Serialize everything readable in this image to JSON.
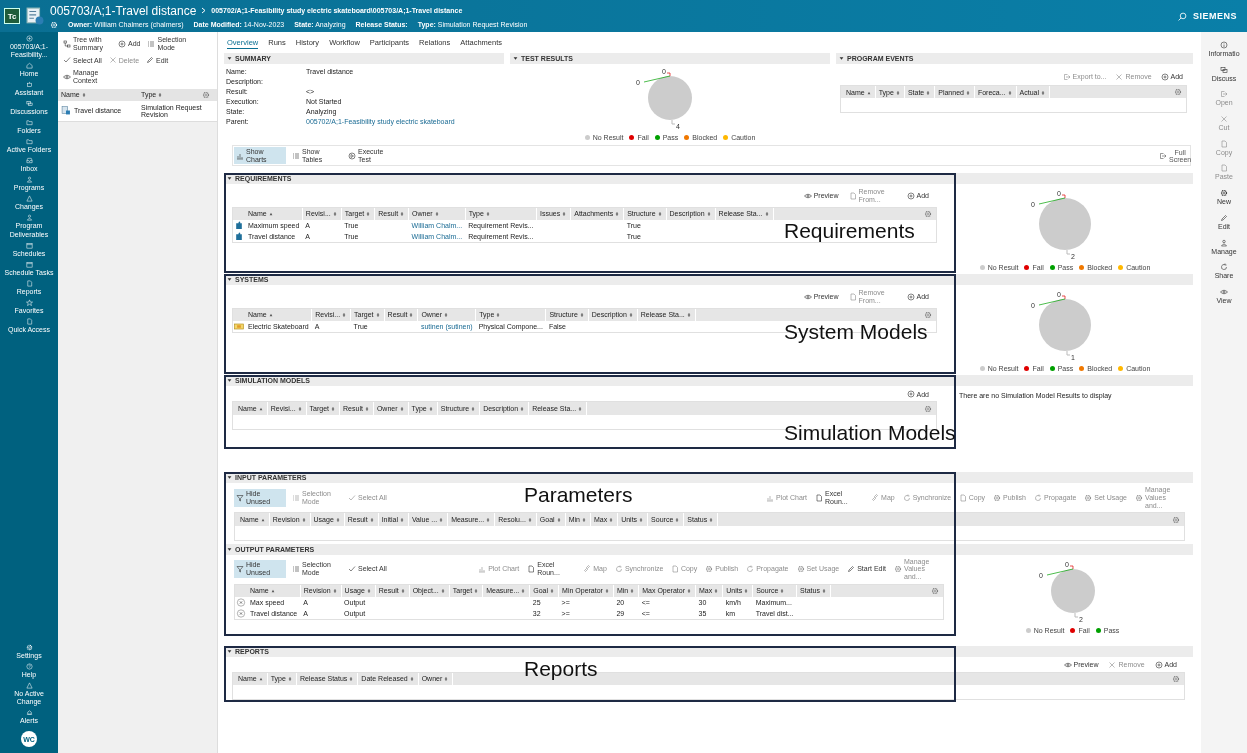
{
  "header": {
    "logo": "Tc",
    "title": "005703/A;1-Travel distance",
    "breadcrumb": "005702/A;1-Feasibility study electric skateboard\\005703/A;1-Travel distance",
    "meta": [
      {
        "label": "Owner:",
        "value": "William Chalmers (chalmers)"
      },
      {
        "label": "Date Modified:",
        "value": "14-Nov-2023"
      },
      {
        "label": "State:",
        "value": "Analyzing"
      },
      {
        "label": "Release Status:"
      },
      {
        "label": "Type:",
        "value": "Simulation Request Revision"
      }
    ],
    "brand": "SIEMENS"
  },
  "nav_rail": {
    "context": "005703/A;1-Feasibility...",
    "items": [
      {
        "label": "Home",
        "kind": "home"
      },
      {
        "label": "Assistant",
        "kind": "bot"
      },
      {
        "label": "Discussions",
        "kind": "chat"
      },
      {
        "label": "Folders",
        "kind": "folder"
      },
      {
        "label": "Active Folders",
        "kind": "folder"
      },
      {
        "label": "Inbox",
        "kind": "inbox"
      },
      {
        "label": "Programs",
        "kind": "people"
      },
      {
        "label": "Changes",
        "kind": "triangle"
      },
      {
        "label": "Program Deliverables",
        "kind": "people"
      },
      {
        "label": "Schedules",
        "kind": "calendar"
      },
      {
        "label": "Schedule Tasks",
        "kind": "calendar"
      },
      {
        "label": "Reports",
        "kind": "doc"
      },
      {
        "label": "Favorites",
        "kind": "star"
      },
      {
        "label": "Quick Access",
        "kind": "doc"
      }
    ],
    "bottom": [
      {
        "label": "Settings",
        "kind": "gear"
      },
      {
        "label": "Help",
        "kind": "help"
      },
      {
        "label": "No Active Change",
        "kind": "triangle"
      },
      {
        "label": "Alerts",
        "kind": "bell"
      }
    ],
    "avatar": "WC"
  },
  "tree_panel": {
    "toolbar": [
      {
        "label": "Tree with Summary",
        "kind": "tree",
        "disabled": false
      },
      {
        "label": "Add",
        "kind": "plus",
        "disabled": false
      },
      {
        "label": "Selection Mode",
        "kind": "list",
        "disabled": false
      },
      {
        "label": "Select All",
        "kind": "check",
        "disabled": false
      },
      {
        "label": "Delete",
        "kind": "cross",
        "disabled": true
      },
      {
        "label": "Edit",
        "kind": "pencil",
        "disabled": false
      },
      {
        "label": "Manage Context",
        "kind": "eye",
        "disabled": false
      }
    ],
    "columns": [
      {
        "label": "Name",
        "sorted": false
      },
      {
        "label": "Type",
        "sorted": false
      }
    ],
    "rows": [
      {
        "kind": "simulation-request",
        "cells": [
          "Travel distance",
          "Simulation Request Revision"
        ]
      }
    ]
  },
  "tabs": [
    {
      "label": "Overview",
      "selected": true
    },
    {
      "label": "Runs",
      "selected": false
    },
    {
      "label": "History",
      "selected": false
    },
    {
      "label": "Workflow",
      "selected": false
    },
    {
      "label": "Participants",
      "selected": false
    },
    {
      "label": "Relations",
      "selected": false
    },
    {
      "label": "Attachments",
      "selected": false
    }
  ],
  "summary": {
    "title": "SUMMARY",
    "fields": [
      {
        "label": "Name:",
        "value": "Travel distance"
      },
      {
        "label": "Description:"
      },
      {
        "label": "Result:",
        "value": "<>"
      },
      {
        "label": "Execution:",
        "value": "Not Started"
      },
      {
        "label": "State:",
        "value": "Analyzing"
      },
      {
        "label": "Parent:",
        "value": {
          "text": "005702/A;1-Feasibility study electric skateboard",
          "link": true
        }
      }
    ]
  },
  "test_results": {
    "title": "TEST RESULTS",
    "chart": {
      "chart_data": {
        "type": "pie",
        "categories": [
          "No Result",
          "Fail",
          "Pass",
          "Blocked",
          "Caution"
        ],
        "values": [
          4,
          0,
          0,
          null,
          null
        ],
        "data_labels": true,
        "value_labels": [
          "4",
          "0",
          "0",
          null,
          null
        ]
      },
      "legend": [
        {
          "color": "#cccccc"
        },
        {
          "color": "#e00000"
        },
        {
          "color": "#00a000"
        },
        {
          "color": "#f07800"
        },
        {
          "color": "#ffb800"
        }
      ]
    }
  },
  "program_events": {
    "title": "PROGRAM EVENTS",
    "toolbar": [
      {
        "label": "Export to...",
        "kind": "export",
        "disabled": true
      },
      {
        "label": "Remove",
        "kind": "cross",
        "disabled": true
      },
      {
        "label": "Add",
        "kind": "plus",
        "disabled": false
      }
    ],
    "table": {
      "columns": [
        {
          "label": "Name",
          "sorted": true
        },
        {
          "label": "Type",
          "sorted": false
        },
        {
          "label": "State",
          "sorted": false
        },
        {
          "label": "Planned",
          "sorted": false
        },
        {
          "label": "Foreca...",
          "sorted": false
        },
        {
          "label": "Actual",
          "sorted": false
        }
      ]
    }
  },
  "view_toolbar": {
    "items": [
      {
        "label": "Show Charts",
        "kind": "chart",
        "selected": true
      },
      {
        "label": "Show Tables",
        "kind": "list",
        "selected": false
      },
      {
        "label": "Execute Test",
        "kind": "play",
        "selected": false
      }
    ],
    "full_screen": "Full Screen"
  },
  "sections": [
    {
      "title": "REQUIREMENTS",
      "annotation": "Requirements",
      "toolbar": [
        {
          "label": "Preview",
          "kind": "eye",
          "disabled": false
        },
        {
          "label": "Remove From...",
          "kind": "doc",
          "disabled": true
        },
        {
          "label": "Add",
          "kind": "plus",
          "disabled": false
        }
      ],
      "table": {
        "columns": [
          {
            "label": "Name",
            "sorted": true
          },
          {
            "label": "Revisi...",
            "sorted": false
          },
          {
            "label": "Target",
            "sorted": false
          },
          {
            "label": "Result",
            "sorted": false
          },
          {
            "label": "Owner",
            "sorted": false
          },
          {
            "label": "Type",
            "sorted": false
          },
          {
            "label": "Issues",
            "sorted": false
          },
          {
            "label": "Attachments",
            "sorted": false
          },
          {
            "label": "Structure",
            "sorted": false
          },
          {
            "label": "Description",
            "sorted": false
          },
          {
            "label": "Release Sta...",
            "sorted": false
          }
        ],
        "rows": [
          {
            "kind": "requirement",
            "cells": [
              "Maximum speed",
              "A",
              "True",
              "",
              {
                "text": "William Chalm...",
                "link": true
              },
              "Requirement Revis...",
              "",
              "",
              "True",
              "",
              ""
            ]
          },
          {
            "kind": "requirement",
            "cells": [
              "Travel distance",
              "A",
              "True",
              "",
              {
                "text": "William Chalm...",
                "link": true
              },
              "Requirement Revis...",
              "",
              "",
              "True",
              "",
              ""
            ]
          }
        ]
      },
      "chart": {
        "chart_data": {
          "type": "pie",
          "categories": [
            "No Result",
            "Fail",
            "Pass",
            "Blocked",
            "Caution"
          ],
          "values": [
            2,
            0,
            0,
            null,
            null
          ],
          "data_labels": true,
          "value_labels": [
            "2",
            "0",
            "0",
            null,
            null
          ]
        },
        "legend": [
          {
            "color": "#cccccc"
          },
          {
            "color": "#e00000"
          },
          {
            "color": "#00a000"
          },
          {
            "color": "#f07800"
          },
          {
            "color": "#ffb800"
          }
        ]
      }
    },
    {
      "title": "SYSTEMS",
      "annotation": "System Models",
      "toolbar": [
        {
          "label": "Preview",
          "kind": "eye",
          "disabled": false
        },
        {
          "label": "Remove From...",
          "kind": "doc",
          "disabled": true
        },
        {
          "label": "Add",
          "kind": "plus",
          "disabled": false
        }
      ],
      "table": {
        "columns": [
          {
            "label": "Name",
            "sorted": true
          },
          {
            "label": "Revisi...",
            "sorted": false
          },
          {
            "label": "Target",
            "sorted": false
          },
          {
            "label": "Result",
            "sorted": false
          },
          {
            "label": "Owner",
            "sorted": false
          },
          {
            "label": "Type",
            "sorted": false
          },
          {
            "label": "Structure",
            "sorted": false
          },
          {
            "label": "Description",
            "sorted": false
          },
          {
            "label": "Release Sta...",
            "sorted": false
          }
        ],
        "rows": [
          {
            "kind": "system",
            "cells": [
              "Electric Skateboard",
              "A",
              "True",
              "",
              {
                "text": "sutinen (sutinen)",
                "link": true
              },
              "Physical Compone...",
              "False",
              "",
              ""
            ]
          }
        ]
      },
      "chart": {
        "chart_data": {
          "type": "pie",
          "categories": [
            "No Result",
            "Fail",
            "Pass",
            "Blocked",
            "Caution"
          ],
          "values": [
            1,
            0,
            0,
            null,
            null
          ],
          "data_labels": true,
          "value_labels": [
            "1",
            "0",
            "0",
            null,
            null
          ]
        },
        "legend": [
          {
            "color": "#cccccc"
          },
          {
            "color": "#e00000"
          },
          {
            "color": "#00a000"
          },
          {
            "color": "#f07800"
          },
          {
            "color": "#ffb800"
          }
        ]
      }
    },
    {
      "title": "SIMULATION MODELS",
      "annotation": "Simulation Models",
      "toolbar": [
        {
          "label": "Add",
          "kind": "plus",
          "disabled": false
        }
      ],
      "table": {
        "columns": [
          {
            "label": "Name",
            "sorted": true
          },
          {
            "label": "Revisi...",
            "sorted": false
          },
          {
            "label": "Target",
            "sorted": false
          },
          {
            "label": "Result",
            "sorted": false
          },
          {
            "label": "Owner",
            "sorted": false
          },
          {
            "label": "Type",
            "sorted": false
          },
          {
            "label": "Structure",
            "sorted": false
          },
          {
            "label": "Description",
            "sorted": false
          },
          {
            "label": "Release Sta...",
            "sorted": false
          }
        ]
      },
      "message": "There are no Simulation Model Results to display"
    }
  ],
  "parameters": {
    "annotation": "Parameters",
    "groups": [
      {
        "title": "INPUT PARAMETERS",
        "toolbar": [
          {
            "label": "Hide Unused",
            "kind": "filter",
            "selected": true,
            "disabled": false
          },
          {
            "label": "Selection Mode",
            "kind": "list",
            "selected": false,
            "disabled": true
          },
          {
            "label": "Select All",
            "kind": "check",
            "selected": false,
            "disabled": true
          }
        ],
        "actions": [
          {
            "label": "Plot Chart",
            "kind": "chart",
            "disabled": true
          },
          {
            "label": "Excel Roun...",
            "kind": "doc",
            "disabled": false
          },
          {
            "label": "Map",
            "kind": "link",
            "disabled": true
          },
          {
            "label": "Synchronize",
            "kind": "sync",
            "disabled": true
          },
          {
            "label": "Copy",
            "kind": "doc",
            "disabled": true
          },
          {
            "label": "Publish",
            "kind": "gear",
            "disabled": true
          },
          {
            "label": "Propagate",
            "kind": "sync",
            "disabled": true
          },
          {
            "label": "Set Usage",
            "kind": "gear",
            "disabled": true
          },
          {
            "label": "Manage Values and...",
            "kind": "gear",
            "disabled": true
          }
        ],
        "table": {
          "columns": [
            {
              "label": "Name",
              "sorted": true
            },
            {
              "label": "Revision",
              "sorted": false
            },
            {
              "label": "Usage",
              "sorted": false
            },
            {
              "label": "Result",
              "sorted": false
            },
            {
              "label": "Initial",
              "sorted": false
            },
            {
              "label": "Value ...",
              "sorted": false
            },
            {
              "label": "Measure...",
              "sorted": false
            },
            {
              "label": "Resolu...",
              "sorted": false
            },
            {
              "label": "Goal",
              "sorted": false
            },
            {
              "label": "Min",
              "sorted": false
            },
            {
              "label": "Max",
              "sorted": false
            },
            {
              "label": "Units",
              "sorted": false
            },
            {
              "label": "Source",
              "sorted": false
            },
            {
              "label": "Status",
              "sorted": false
            }
          ]
        }
      },
      {
        "title": "OUTPUT PARAMETERS",
        "toolbar": [
          {
            "label": "Hide Unused",
            "kind": "filter",
            "selected": true,
            "disabled": false
          },
          {
            "label": "Selection Mode",
            "kind": "list",
            "selected": false,
            "disabled": false
          },
          {
            "label": "Select All",
            "kind": "check",
            "selected": false,
            "disabled": false
          }
        ],
        "actions": [
          {
            "label": "Plot Chart",
            "kind": "chart",
            "disabled": true
          },
          {
            "label": "Excel Roun...",
            "kind": "doc",
            "disabled": false
          },
          {
            "label": "Map",
            "kind": "link",
            "disabled": true
          },
          {
            "label": "Synchronize",
            "kind": "sync",
            "disabled": true
          },
          {
            "label": "Copy",
            "kind": "doc",
            "disabled": true
          },
          {
            "label": "Publish",
            "kind": "gear",
            "disabled": true
          },
          {
            "label": "Propagate",
            "kind": "sync",
            "disabled": true
          },
          {
            "label": "Set Usage",
            "kind": "gear",
            "disabled": true
          },
          {
            "label": "Start Edit",
            "kind": "pencil",
            "disabled": false
          },
          {
            "label": "Manage Values and...",
            "kind": "gear",
            "disabled": true
          }
        ],
        "table": {
          "columns": [
            {
              "label": "Name",
              "sorted": true
            },
            {
              "label": "Revision",
              "sorted": false
            },
            {
              "label": "Usage",
              "sorted": false
            },
            {
              "label": "Result",
              "sorted": false
            },
            {
              "label": "Object...",
              "sorted": false
            },
            {
              "label": "Target",
              "sorted": false
            },
            {
              "label": "Measure...",
              "sorted": false
            },
            {
              "label": "Goal",
              "sorted": false
            },
            {
              "label": "Min Operator",
              "sorted": false
            },
            {
              "label": "Min",
              "sorted": false
            },
            {
              "label": "Max Operator",
              "sorted": false
            },
            {
              "label": "Max",
              "sorted": false
            },
            {
              "label": "Units",
              "sorted": false
            },
            {
              "label": "Source",
              "sorted": false
            },
            {
              "label": "Status",
              "sorted": false
            }
          ],
          "rows": [
            {
              "kind": "parameter",
              "cells": [
                "Max speed",
                "A",
                "Output",
                "",
                "",
                "",
                "",
                "25",
                ">=",
                "20",
                "<=",
                "30",
                "km/h",
                "Maximum...",
                ""
              ]
            },
            {
              "kind": "parameter",
              "cells": [
                "Travel distance",
                "A",
                "Output",
                "",
                "",
                "",
                "",
                "32",
                ">=",
                "29",
                "<=",
                "35",
                "km",
                "Travel dist...",
                ""
              ]
            }
          ]
        },
        "chart": {
          "chart_data": {
            "type": "pie",
            "categories": [
              "No Result",
              "Fail",
              "Pass"
            ],
            "values": [
              2,
              0,
              0
            ],
            "data_labels": true,
            "value_labels": [
              "2",
              "0",
              "0"
            ]
          },
          "legend": [
            {
              "color": "#cccccc"
            },
            {
              "color": "#e00000"
            },
            {
              "color": "#00a000"
            }
          ]
        }
      }
    ]
  },
  "reports": {
    "title": "REPORTS",
    "annotation": "Reports",
    "toolbar": [
      {
        "label": "Preview",
        "kind": "eye",
        "disabled": false
      },
      {
        "label": "Remove",
        "kind": "cross",
        "disabled": true
      },
      {
        "label": "Add",
        "kind": "plus",
        "disabled": false
      }
    ],
    "table": {
      "columns": [
        {
          "label": "Name",
          "sorted": true
        },
        {
          "label": "Type",
          "sorted": false
        },
        {
          "label": "Release Status",
          "sorted": false
        },
        {
          "label": "Date Released",
          "sorted": false
        },
        {
          "label": "Owner",
          "sorted": false
        }
      ]
    }
  },
  "right_rail": [
    {
      "label": "Informatio",
      "kind": "info",
      "disabled": false
    },
    {
      "label": "Discuss",
      "kind": "chat",
      "disabled": false
    },
    {
      "label": "Open",
      "kind": "export",
      "disabled": true
    },
    {
      "label": "Cut",
      "kind": "cross",
      "disabled": true
    },
    {
      "label": "Copy",
      "kind": "doc",
      "disabled": true
    },
    {
      "label": "Paste",
      "kind": "doc",
      "disabled": true
    },
    {
      "label": "New",
      "kind": "gear",
      "disabled": false
    },
    {
      "label": "Edit",
      "kind": "pencil",
      "disabled": false
    },
    {
      "label": "Manage",
      "kind": "people",
      "disabled": false
    },
    {
      "label": "Share",
      "kind": "sync",
      "disabled": false
    },
    {
      "label": "View",
      "kind": "eye",
      "disabled": false
    }
  ]
}
